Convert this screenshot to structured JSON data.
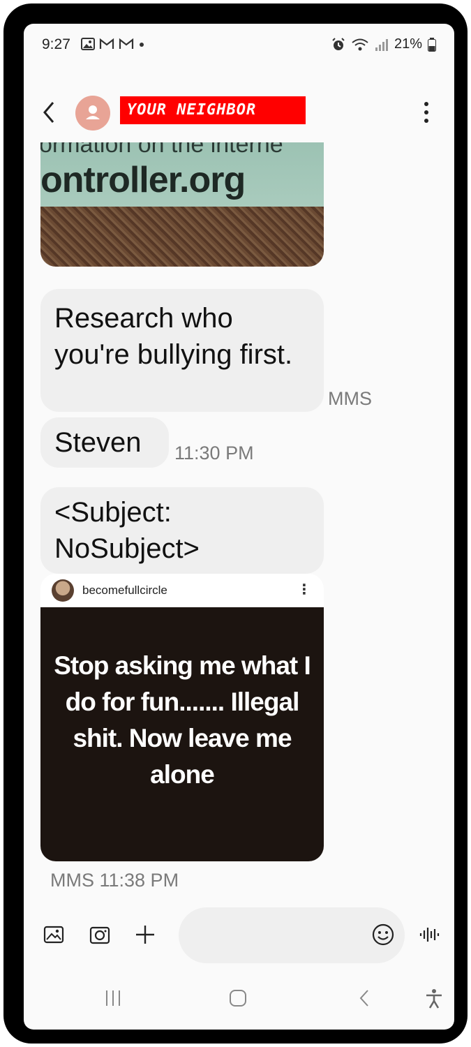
{
  "status_bar": {
    "time": "9:27",
    "battery": "21%"
  },
  "header": {
    "contact_name": "YOUR NEIGHBOR",
    "contact_badge_color": "#ff0000",
    "avatar_color": "#e8a496"
  },
  "messages": [
    {
      "type": "image",
      "image_text_line1": "ormation on the interne",
      "image_text_line2": "ontroller.org"
    },
    {
      "type": "text",
      "text": "Research who you're bullying first.",
      "meta": "MMS"
    },
    {
      "type": "text",
      "text": "Steven",
      "meta": "11:30 PM"
    },
    {
      "type": "text",
      "text": "<Subject: NoSubject>"
    },
    {
      "type": "image",
      "ig_username": "becomefullcircle",
      "ig_more": "⋮",
      "meme_text": "Stop asking me what I do for fun....... Illegal shit. Now leave me alone",
      "meta": "MMS 11:38 PM"
    }
  ],
  "composer": {
    "icons": [
      "gallery-icon",
      "camera-icon",
      "plus-icon",
      "emoji-icon",
      "voice-icon"
    ]
  },
  "navbar": {
    "icons": [
      "recents-icon",
      "home-icon",
      "back-icon",
      "accessibility-icon"
    ]
  }
}
